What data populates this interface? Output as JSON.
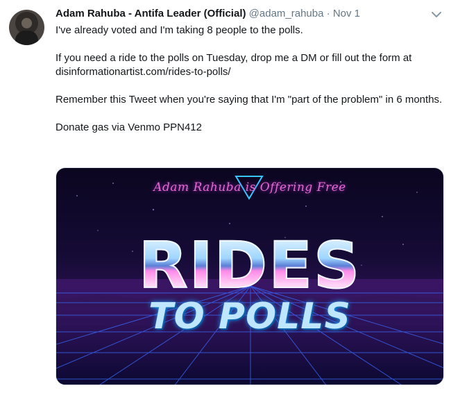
{
  "tweet": {
    "author_name": "Adam Rahuba - Antifa Leader (Official)",
    "handle": "@adam_rahuba",
    "separator": "·",
    "date": "Nov 1",
    "paragraphs": [
      "I've already voted and I'm taking 8 people to the polls.",
      "If you need a ride to the polls on Tuesday, drop me a DM or fill out the form at disinformationartist.com/rides-to-polls/",
      "Remember this Tweet when you're saying that I'm \"part of the problem\" in 6 months.",
      "Donate gas via Venmo PPN412"
    ]
  },
  "media": {
    "tagline": "Adam Rahuba is Offering Free",
    "big_word": "RIDES",
    "sub_word": "TO POLLS"
  },
  "icons": {
    "menu": "chevron-down-icon",
    "avatar": "avatar"
  },
  "colors": {
    "name": "#14171a",
    "secondary": "#657786",
    "accent_pink": "#e36bd0",
    "accent_blue": "#1aa0ff"
  }
}
